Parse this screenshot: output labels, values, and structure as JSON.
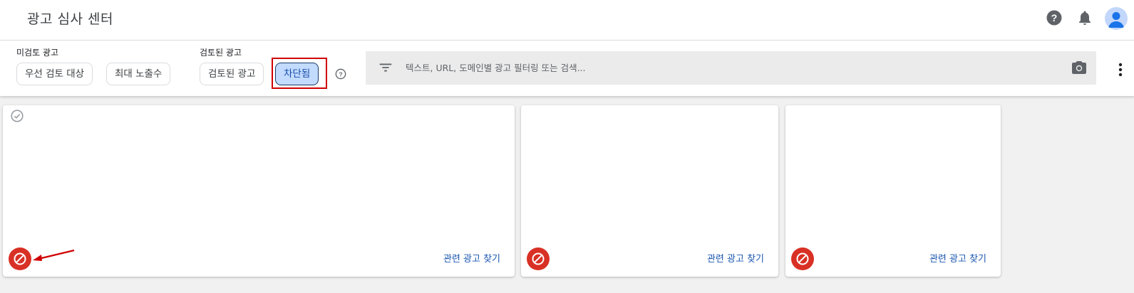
{
  "header": {
    "title": "광고 심사 센터",
    "icons": [
      "help-icon",
      "notifications-bell-icon",
      "account-avatar"
    ]
  },
  "filters": {
    "unreviewed": {
      "label": "미검토 광고",
      "chips": [
        "우선 검토 대상",
        "최대 노출수"
      ]
    },
    "reviewed": {
      "label": "검토된 광고",
      "chips": [
        "검토된 광고",
        "차단됨"
      ],
      "selected": "차단됨"
    },
    "help_icon": "help-outline-icon"
  },
  "search": {
    "placeholder": "텍스트, URL, 도메인별 광고 필터링 또는 검색...",
    "icons": [
      "filter-list-icon",
      "camera-icon"
    ]
  },
  "cards": [
    {
      "link": "관련 광고 찾기",
      "status_icon": "block-icon",
      "selected_icon": "check-circle-icon"
    },
    {
      "link": "관련 광고 찾기",
      "status_icon": "block-icon"
    },
    {
      "link": "관련 광고 찾기",
      "status_icon": "block-icon"
    }
  ],
  "colors": {
    "accent": "#1a56b0",
    "selected_chip_bg": "#c2dbff",
    "blocked_badge": "#d93025",
    "annotation_red": "#d00000"
  }
}
